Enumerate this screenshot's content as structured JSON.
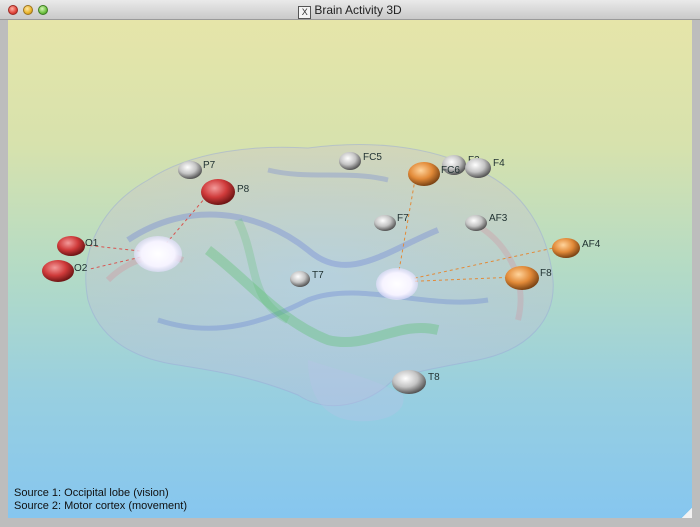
{
  "window": {
    "title": "Brain Activity 3D",
    "app_icon": "X"
  },
  "electrodes": [
    {
      "label": "P7",
      "color": "gray"
    },
    {
      "label": "P8",
      "color": "red"
    },
    {
      "label": "O1",
      "color": "red"
    },
    {
      "label": "O2",
      "color": "red"
    },
    {
      "label": "FC5",
      "color": "gray"
    },
    {
      "label": "FC6",
      "color": "orange"
    },
    {
      "label": "F3",
      "color": "gray"
    },
    {
      "label": "F4",
      "color": "gray"
    },
    {
      "label": "F7",
      "color": "gray"
    },
    {
      "label": "AF3",
      "color": "gray"
    },
    {
      "label": "AF4",
      "color": "orange"
    },
    {
      "label": "F8",
      "color": "orange"
    },
    {
      "label": "T7",
      "color": "gray"
    },
    {
      "label": "T8",
      "color": "gray"
    }
  ],
  "legend": {
    "source1": "Source 1: Occipital lobe (vision)",
    "source2": "Source 2: Motor cortex (movement)"
  },
  "colors": {
    "red": "#cf3a3a",
    "orange": "#e28a38",
    "gray": "#bdbdbd",
    "source_glow": "#ffffff"
  }
}
